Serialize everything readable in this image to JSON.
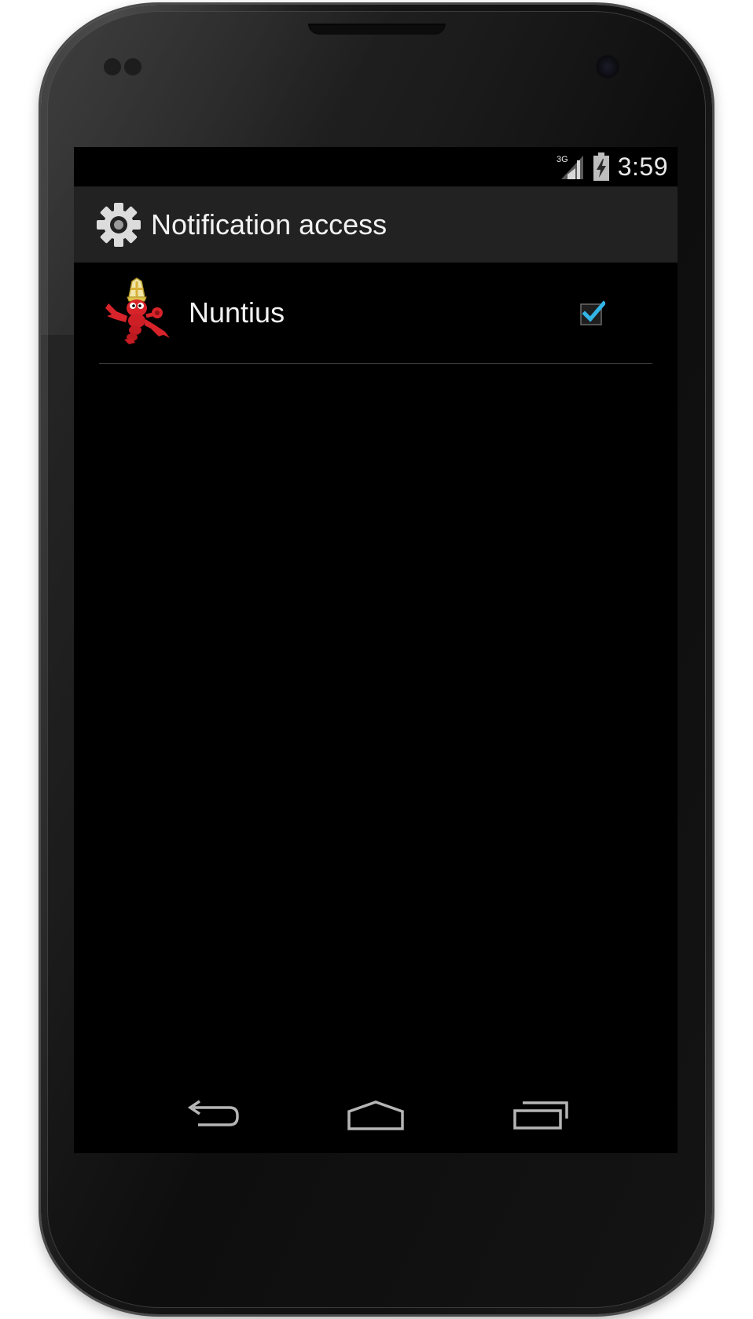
{
  "status_bar": {
    "network_label": "3G",
    "time": "3:59"
  },
  "action_bar": {
    "title": "Notification access",
    "icon": "settings-gear-icon"
  },
  "listeners": [
    {
      "label": "Nuntius",
      "icon": "lobster-bishop-app-icon",
      "enabled": true
    }
  ],
  "navigation": {
    "buttons": [
      "back",
      "home",
      "recent-apps"
    ]
  },
  "colors": {
    "checkbox_accent": "#33b5e5",
    "action_bar_bg": "#222222",
    "screen_bg": "#000000"
  }
}
